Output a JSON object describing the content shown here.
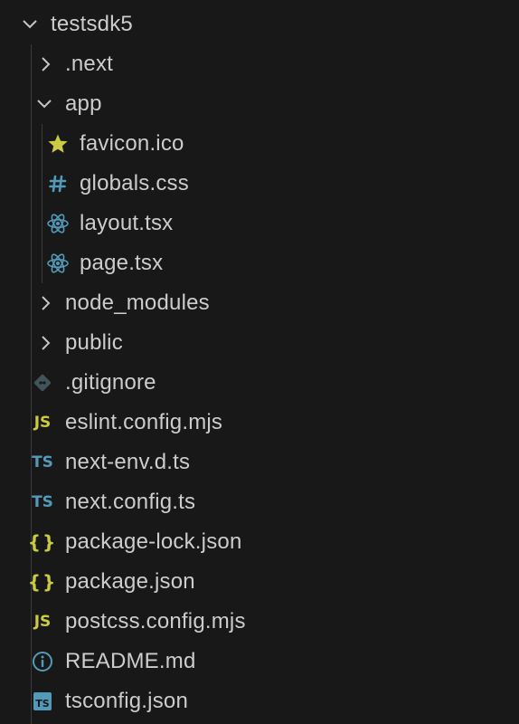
{
  "explorer": {
    "root": {
      "label": "testsdk5",
      "icon": "chevron-down-icon"
    },
    "items": [
      {
        "label": ".next",
        "kind": "folder",
        "icon": "chevron-right-icon"
      },
      {
        "label": "app",
        "kind": "folder-open",
        "icon": "chevron-down-icon"
      },
      {
        "label": "favicon.ico",
        "kind": "file",
        "icon": "star-icon"
      },
      {
        "label": "globals.css",
        "kind": "file",
        "icon": "hash-icon"
      },
      {
        "label": "layout.tsx",
        "kind": "file",
        "icon": "react-icon"
      },
      {
        "label": "page.tsx",
        "kind": "file",
        "icon": "react-icon"
      },
      {
        "label": "node_modules",
        "kind": "folder",
        "icon": "chevron-right-icon"
      },
      {
        "label": "public",
        "kind": "folder",
        "icon": "chevron-right-icon"
      },
      {
        "label": ".gitignore",
        "kind": "file",
        "icon": "git-icon"
      },
      {
        "label": "eslint.config.mjs",
        "kind": "file",
        "icon": "js-icon",
        "glyph": "JS"
      },
      {
        "label": "next-env.d.ts",
        "kind": "file",
        "icon": "ts-icon",
        "glyph": "TS"
      },
      {
        "label": "next.config.ts",
        "kind": "file",
        "icon": "ts-icon",
        "glyph": "TS"
      },
      {
        "label": "package-lock.json",
        "kind": "file",
        "icon": "json-icon",
        "glyph": "{}"
      },
      {
        "label": "package.json",
        "kind": "file",
        "icon": "json-icon",
        "glyph": "{}"
      },
      {
        "label": "postcss.config.mjs",
        "kind": "file",
        "icon": "js-icon",
        "glyph": "JS"
      },
      {
        "label": "README.md",
        "kind": "file",
        "icon": "info-icon"
      },
      {
        "label": "tsconfig.json",
        "kind": "file",
        "icon": "tsconfig-icon"
      }
    ]
  },
  "colors": {
    "background": "#181818",
    "text": "#cccccc",
    "chevron": "#c5c5c5",
    "star": "#cbcb41",
    "css": "#519aba",
    "react": "#519aba",
    "git": "#41535b",
    "js": "#cbcb41",
    "ts": "#519aba",
    "json": "#cbcb41",
    "info": "#519aba"
  }
}
